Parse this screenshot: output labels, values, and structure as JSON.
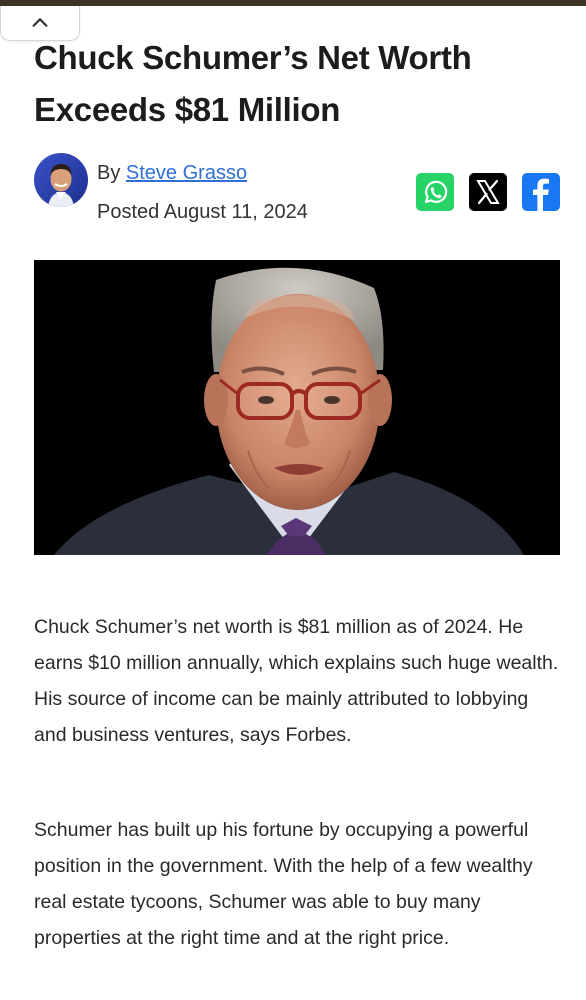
{
  "article": {
    "headline": "Chuck Schumer’s Net Worth Exceeds $81 Million",
    "byline": {
      "prefix": "By ",
      "author": "Steve Grasso",
      "posted": "Posted August 11, 2024"
    },
    "share": [
      {
        "name": "whatsapp",
        "icon": "whatsapp-icon",
        "color": "#25d366"
      },
      {
        "name": "x",
        "icon": "x-icon",
        "color": "#000000"
      },
      {
        "name": "facebook",
        "icon": "facebook-icon",
        "color": "#1877f2"
      }
    ],
    "paragraphs": [
      "Chuck Schumer’s net worth is $81 million as of 2024. He earns $10 million annually, which explains such huge wealth. His source of income can be mainly attributed to lobbying and business ventures, says Forbes.",
      "Schumer has built up his fortune by occupying a powerful position in the government. With the help of a few wealthy real estate tycoons, Schumer was able to buy many properties at the right time and at the right price."
    ]
  },
  "ui": {
    "collapse_icon": "chevron-up-icon"
  }
}
